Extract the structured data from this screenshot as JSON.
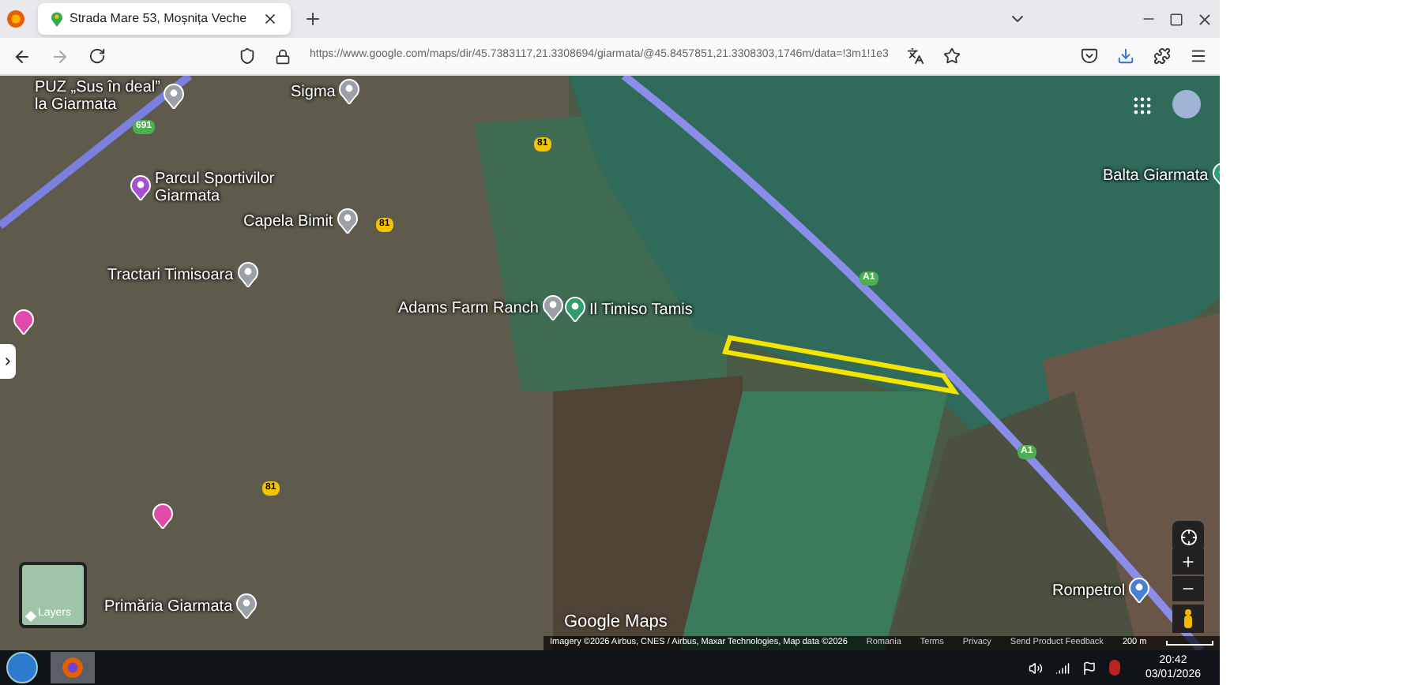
{
  "browser": {
    "tab": {
      "title": "Strada Mare 53, Moșnița Veche"
    },
    "url": "https://www.google.com/maps/dir/45.7383117,21.3308694/giarmata/@45.8457851,21.3308303,1746m/data=!3m1!1e3"
  },
  "map": {
    "places": [
      {
        "name": "PUZ „Sus în deal”\nla Giarmata",
        "color": "#9aa0a6"
      },
      {
        "name": "Sigma",
        "color": "#9aa0a6"
      },
      {
        "name": "Parcul Sportivilor\nGiarmata",
        "color": "#a64fcf"
      },
      {
        "name": "Capela Bimit",
        "color": "#9aa0a6"
      },
      {
        "name": "Tractari Timisoara",
        "color": "#9aa0a6"
      },
      {
        "name": "Adams Farm Ranch",
        "color": "#9aa0a6"
      },
      {
        "name": "Il Timiso Tamis",
        "color": "#2e9e6a"
      },
      {
        "name": "Balta Giarmata",
        "color": "#2e9e6a"
      },
      {
        "name": "Primăria Giarmata",
        "color": "#9aa0a6"
      },
      {
        "name": "Rompetrol",
        "color": "#4a7fd6"
      }
    ],
    "road_shields": [
      "691",
      "81",
      "81",
      "A1",
      "A1",
      "81"
    ],
    "layers_label": "Layers",
    "logo": "Google Maps",
    "attribution": "Imagery ©2026 Airbus, CNES / Airbus, Maxar Technologies, Map data ©2026",
    "footer_links": [
      "Romania",
      "Terms",
      "Privacy",
      "Send Product Feedback"
    ],
    "scale": "200 m"
  },
  "taskbar": {
    "time": "20:42",
    "date": "03/01/2026"
  }
}
